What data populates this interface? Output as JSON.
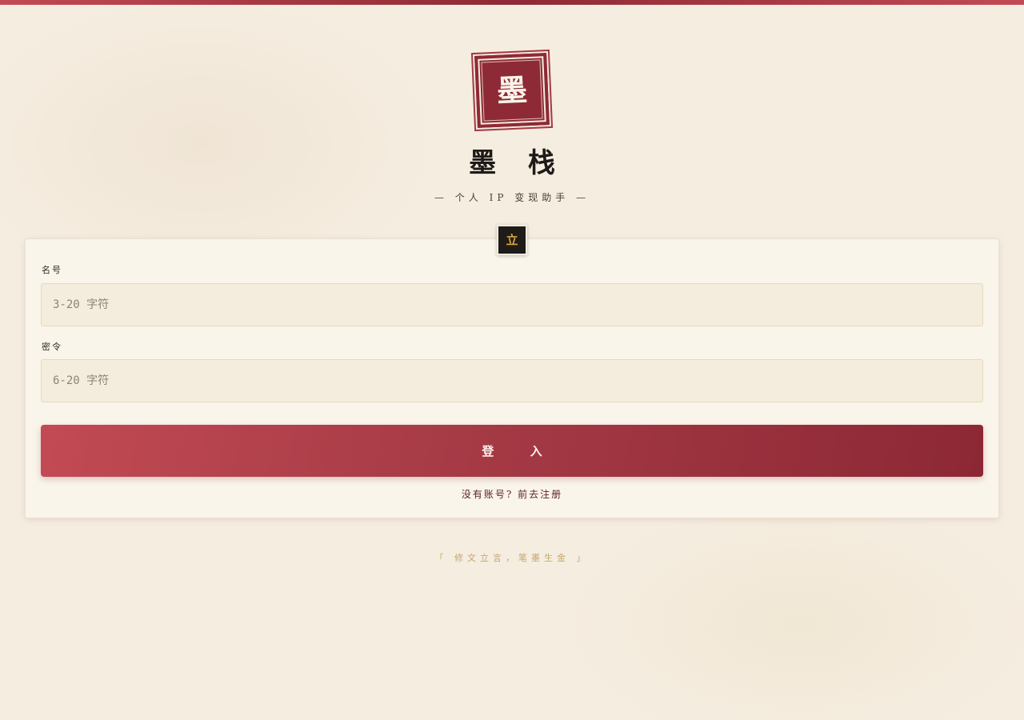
{
  "brand": {
    "seal_char": "墨",
    "title": "墨 栈",
    "subtitle": "— 个人 IP 变现助手 —"
  },
  "form": {
    "badge": "立",
    "username": {
      "label": "名号",
      "placeholder": "3-20 字符",
      "value": ""
    },
    "password": {
      "label": "密令",
      "placeholder": "6-20 字符",
      "value": ""
    },
    "submit_label": "登 入",
    "register_link": "没有账号? 前去注册"
  },
  "footer": {
    "motto": "「 修文立言，笔墨生金 」"
  },
  "colors": {
    "primary": "#8e2a35",
    "accent": "#c24a54",
    "gold": "#d9a33b",
    "background": "#f5ede0"
  }
}
